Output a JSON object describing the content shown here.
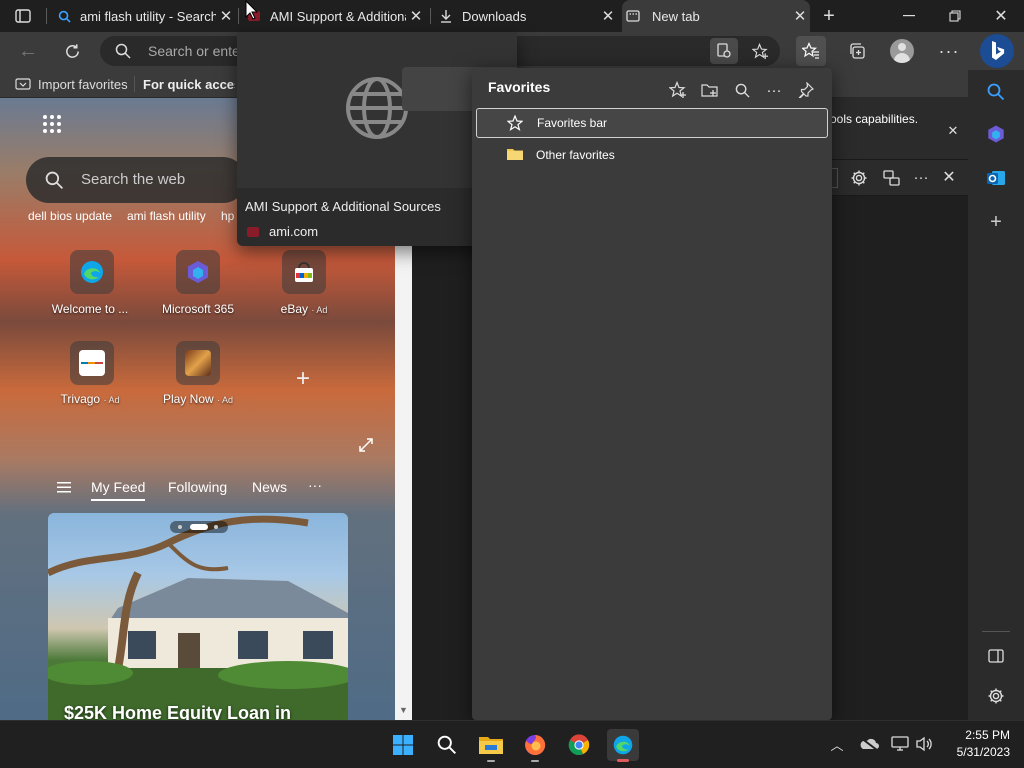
{
  "tabs": [
    {
      "title": "ami flash utility - Search",
      "icon": "search-icon"
    },
    {
      "title": "AMI Support & Additional Sources",
      "icon": "ami-favicon"
    },
    {
      "title": "Downloads",
      "icon": "download-icon"
    },
    {
      "title": "New tab",
      "icon": "new-tab-icon"
    }
  ],
  "address": {
    "placeholder": "Search or enter web address"
  },
  "favbar": {
    "import_label": "Import favorites",
    "quick_access": "For quick access, place your favorites here on the favorites bar."
  },
  "hover_card": {
    "title": "AMI Support & Additional Sources",
    "domain": "ami.com"
  },
  "newtab": {
    "search_placeholder": "Search the web",
    "suggestions": [
      "dell bios update",
      "ami flash utility",
      "hp"
    ],
    "tiles_row1": [
      {
        "label": "Welcome to ...",
        "ad": ""
      },
      {
        "label": "Microsoft 365",
        "ad": ""
      },
      {
        "label": "eBay",
        "ad": "· Ad"
      }
    ],
    "tiles_row2": [
      {
        "label": "Trivago",
        "ad": "· Ad"
      },
      {
        "label": "Play Now",
        "ad": "· Ad"
      }
    ],
    "feed_tabs": [
      "My Feed",
      "Following",
      "News"
    ],
    "card_title": "$25K Home Equity Loan in"
  },
  "info_bar": {
    "text": "ools capabilities."
  },
  "favorites_panel": {
    "title": "Favorites",
    "items": [
      {
        "label": "Favorites bar",
        "icon": "star-outline-icon"
      },
      {
        "label": "Other favorites",
        "icon": "folder-icon"
      }
    ]
  },
  "taskbar": {
    "time": "2:55 PM",
    "date": "5/31/2023"
  },
  "colors": {
    "accent": "#0078d4",
    "bing": "#2c7be5",
    "folder": "#f2c94c",
    "edge": "#0fa5e9"
  }
}
